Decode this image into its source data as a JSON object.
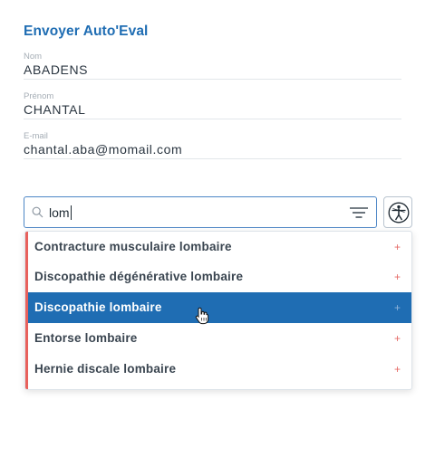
{
  "form": {
    "title": "Envoyer Auto'Eval",
    "nom": {
      "label": "Nom",
      "value": "ABADENS"
    },
    "prenom": {
      "label": "Prénom",
      "value": "CHANTAL"
    },
    "email": {
      "label": "E-mail",
      "value": "chantal.aba@momail.com"
    }
  },
  "search": {
    "query": "lom",
    "icon": "search-icon"
  },
  "filter_icon": "filter-icon",
  "body_button_icon": "body-figure-icon",
  "suggestions": [
    {
      "label": "Contracture musculaire lombaire",
      "action": "+",
      "selected": false
    },
    {
      "label": "Discopathie dégénérative lombaire",
      "action": "+",
      "selected": false
    },
    {
      "label": "Discopathie lombaire",
      "action": "+",
      "selected": true
    },
    {
      "label": "Entorse lombaire",
      "action": "+",
      "selected": false
    },
    {
      "label": "Hernie discale lombaire",
      "action": "+",
      "selected": false
    }
  ],
  "colors": {
    "accent": "#1f6db3",
    "selected_bg": "#1f6db3",
    "plus": "#e56a66",
    "left_bar": "#e8615c"
  }
}
